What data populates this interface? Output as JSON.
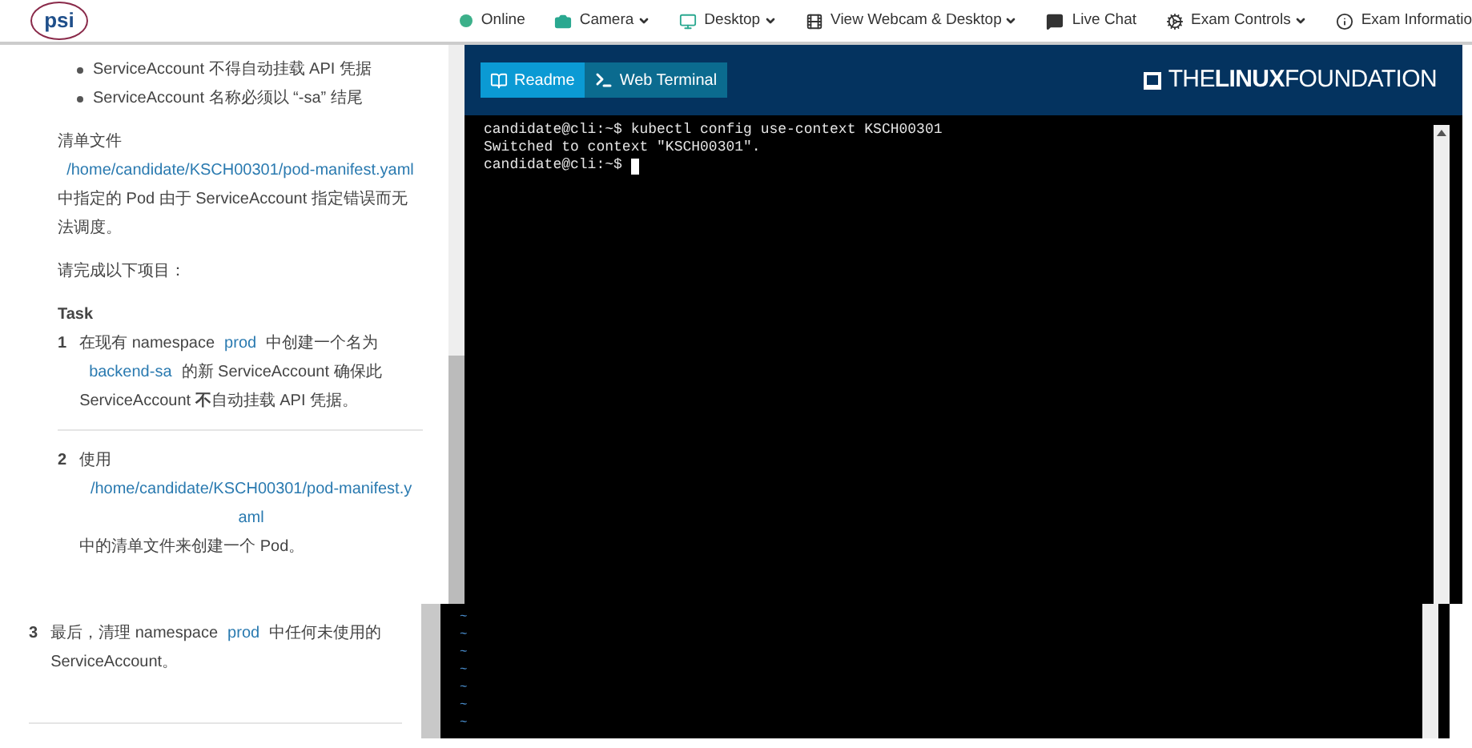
{
  "header": {
    "logo": "psi",
    "nav": [
      {
        "label": "Online",
        "kind": "status",
        "color": "#3cb08a",
        "dropdown": false
      },
      {
        "label": "Camera",
        "kind": "camera",
        "dropdown": true
      },
      {
        "label": "Desktop",
        "kind": "desktop",
        "dropdown": true
      },
      {
        "label": "View Webcam & Desktop",
        "kind": "film",
        "dropdown": true
      },
      {
        "label": "Live Chat",
        "kind": "chat",
        "dropdown": false
      },
      {
        "label": "Exam Controls",
        "kind": "gears",
        "dropdown": true
      },
      {
        "label": "Exam Informatio",
        "kind": "info",
        "dropdown": false
      }
    ]
  },
  "readme": {
    "requirements": [
      "ServiceAccount 不得自动挂载 API 凭据",
      "ServiceAccount 名称必须以 “-sa” 结尾"
    ],
    "manifest_intro": "清单文件",
    "manifest_path": "/home/candidate/KSCH00301/pod-manifest.yaml",
    "manifest_note": "中指定的 Pod 由于 ServiceAccount 指定错误而无法调度。",
    "prompt": "请完成以下项目：",
    "task_heading": "Task",
    "tasks": [
      {
        "number": "1",
        "segments": [
          {
            "kind": "text",
            "text": "在现有 namespace"
          },
          {
            "kind": "code",
            "text": "prod"
          },
          {
            "kind": "text",
            "text": "中创建一个名为"
          },
          {
            "kind": "code",
            "text": "backend-sa"
          },
          {
            "kind": "text",
            "text": "的新 ServiceAccount 确保此 ServiceAccount **不**自动挂载 API 凭据。"
          }
        ]
      },
      {
        "number": "2",
        "segments": [
          {
            "kind": "text",
            "text": "使用"
          },
          {
            "kind": "path",
            "text": "/home/candidate/KSCH00301/pod-manifest.yaml"
          },
          {
            "kind": "text",
            "text": "中的清单文件来创建一个 Pod。"
          }
        ]
      }
    ],
    "last_task": {
      "number": "3",
      "segments": [
        {
          "kind": "text",
          "text": "最后，清理 namespace"
        },
        {
          "kind": "code",
          "text": "prod"
        },
        {
          "kind": "text",
          "text": "中任何未使用的 ServiceAccount。"
        }
      ]
    }
  },
  "terminal": {
    "tabs": [
      {
        "label": "Readme",
        "kind": "book",
        "selected": true
      },
      {
        "label": "Web Terminal",
        "kind": "prompt",
        "selected": false
      }
    ],
    "brand": "THE**LINUX**FOUNDATION",
    "lines": [
      "candidate@cli:~$ kubectl config use-context KSCH00301",
      "Switched to context \"KSCH00301\".",
      "candidate@cli:~$"
    ],
    "cursor": true,
    "vim_lines": [
      "~",
      "~",
      "~",
      "~",
      "~",
      "~",
      "~"
    ]
  }
}
